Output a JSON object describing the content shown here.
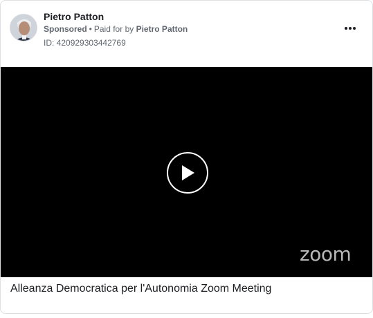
{
  "post": {
    "author_name": "Pietro Patton",
    "sponsored_label": "Sponsored",
    "separator": "•",
    "paid_for_prefix": "Paid for by",
    "paid_for_name": "Pietro Patton",
    "ad_id": "ID: 420929303442769",
    "more_icon": "more-horizontal-icon"
  },
  "video": {
    "play_icon": "play-icon",
    "watermark": "zoom",
    "background_color": "#000000"
  },
  "caption": "Alleanza Democratica per l'Autonomia Zoom Meeting"
}
